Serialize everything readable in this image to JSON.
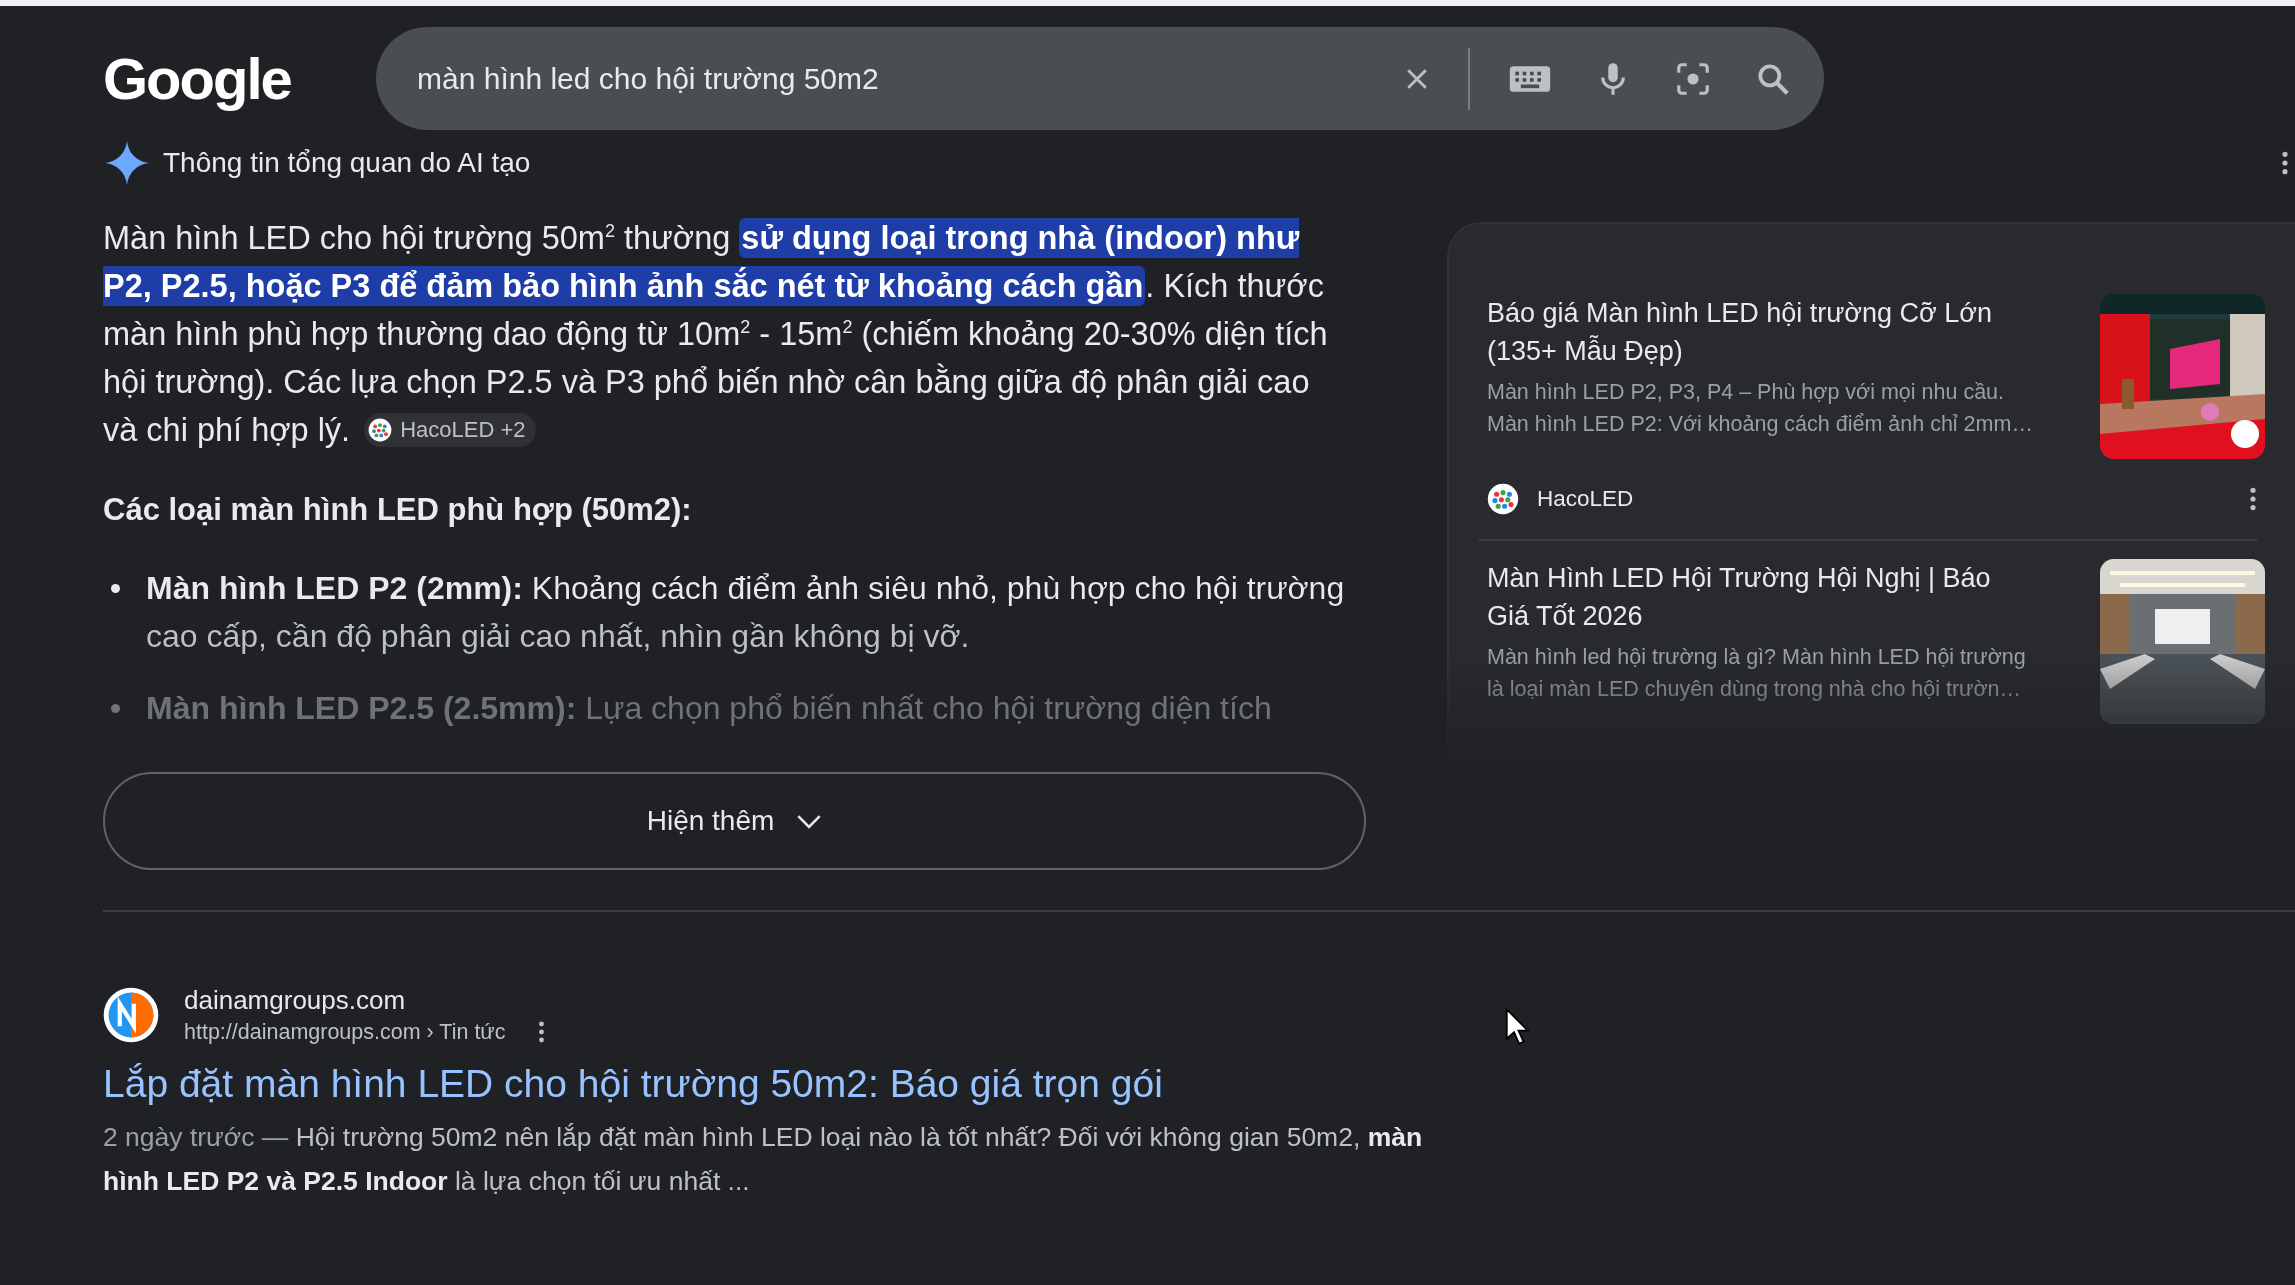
{
  "logo": "Google",
  "search": {
    "value": "màn hình led cho hội trường 50m2"
  },
  "ai_overview": {
    "title": "Thông tin tổng quan do AI tạo",
    "paragraph": [
      {
        "text": "Màn hình LED cho hội trường 50m$^{2}$ thường ",
        "highlighted": false
      },
      {
        "text": "sử dụng loại trong nhà (indoor) như P2, P2.5, hoặc P3 để đảm bảo hình ảnh sắc nét từ khoảng cách gần",
        "highlighted": true
      },
      {
        "text": ". Kích thước màn hình phù hợp thường dao động từ 10m$^{2}$ - 15m$^{2}$ (chiếm khoảng 20-30% diện tích hội trường). Các lựa chọn P2.5 và P3 phổ biến nhờ cân bằng giữa độ phân giải cao và chi phí hợp lý.",
        "highlighted": false
      }
    ],
    "source_chip": "HacoLED +2",
    "heading": "Các loại màn hình LED phù hợp (50m2):",
    "bullets": [
      {
        "term": "Màn hình LED P2 (2mm):",
        "text": "Khoảng cách điểm ảnh siêu nhỏ, phù hợp cho hội trường cao cấp, cần độ phân giải cao nhất, nhìn gần không bị vỡ."
      },
      {
        "term": "Màn hình LED P2.5 (2.5mm):",
        "text": "Lựa chọn phổ biến nhất cho hội trường diện tích"
      }
    ],
    "more_button": "Hiện thêm",
    "sources": [
      {
        "title": "Báo giá Màn hình LED hội trường Cỡ Lớn (135+ Mẫu Đẹp)",
        "snippet": [
          "Màn hình LED P2, P3, P4 – Phù hợp với mọi nhu cầu.",
          "Màn hình LED P2: Với khoảng cách điểm ảnh chỉ 2mm…"
        ],
        "source": "HacoLED"
      },
      {
        "title": "Màn Hình LED Hội Trường Hội Nghị | Báo Giá Tốt 2026",
        "snippet": [
          "Màn hình led hội trường là gì? Màn hình LED hội trường",
          "là loại màn LED chuyên dùng trong nhà cho hội trườn…"
        ]
      }
    ]
  },
  "results": [
    {
      "site_name": "dainamgroups.com",
      "url": "http://dainamgroups.com › Tin tức",
      "title": "Lắp đặt màn hình LED cho hội trường 50m2: Báo giá trọn gói",
      "date": "2 ngày trước —",
      "snippet": "Hội trường 50m2 nên lắp đặt màn hình LED loại nào là tốt nhất? Đối với không gian 50m2, **màn hình LED P2 và P2.5 Indoor** là lựa chọn tối ưu nhất ..."
    }
  ]
}
